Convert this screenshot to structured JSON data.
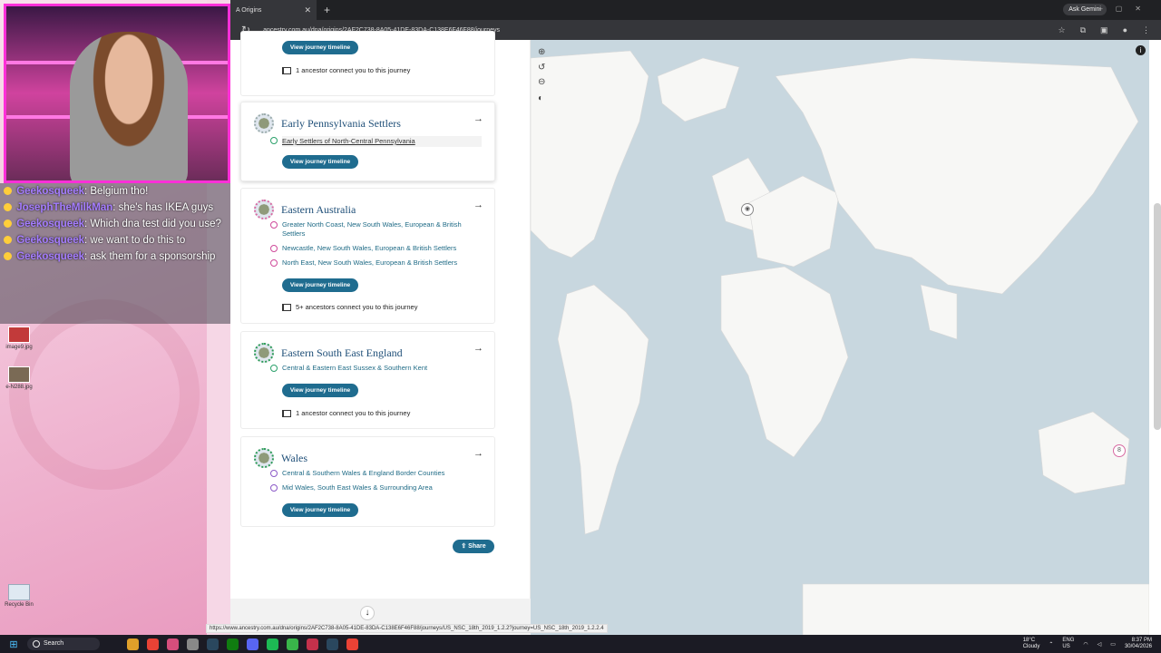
{
  "desktop": {
    "icons": [
      {
        "label": "image9.jpg"
      },
      {
        "label": "e-N288.jpg"
      },
      {
        "label": "Recycle Bin"
      }
    ]
  },
  "chat": {
    "messages": [
      {
        "user": "Geekosqueek",
        "text": ": Belgium tho!"
      },
      {
        "user": "JosephTheMilkMan",
        "text": ": she's has IKEA guys"
      },
      {
        "user": "Geekosqueek",
        "text": ": Which dna test did you use?"
      },
      {
        "user": "Geekosqueek",
        "text": ": we want to do this to"
      },
      {
        "user": "Geekosqueek",
        "text": ": ask them for a sponsorship"
      }
    ]
  },
  "browser": {
    "tab_title": "A Origins",
    "new_tab": "+",
    "ask_gemini": "Ask Gemini",
    "url": "ancestry.com.au/dna/origins/2AF2C738-8A05-41DE-83DA-C138E6F46F88/journeys",
    "status_url": "https://www.ancestry.com.au/dna/origins/2AF2C738-8A05-41DE-83DA-C138E6F46F88/journeys/US_NSC_18th_2019_1.2.2?journey=US_NSC_18th_2019_1.2.2.4"
  },
  "journeys": {
    "timeline_label": "View journey timeline",
    "share_label": "Share",
    "top_partial": {
      "ancestor_text": "1 ancestor connect you to this journey"
    },
    "cards": [
      {
        "title": "Early Pennsylvania Settlers",
        "communities": [
          "Early Settlers of North-Central Pennsylvania"
        ]
      },
      {
        "title": "Eastern Australia",
        "communities": [
          "Greater North Coast, New South Wales, European & British Settlers",
          "Newcastle, New South Wales, European & British Settlers",
          "North East, New South Wales, European & British Settlers"
        ],
        "ancestor_text": "5+ ancestors connect you to this journey"
      },
      {
        "title": "Eastern South East England",
        "communities": [
          "Central & Eastern East Sussex & Southern Kent"
        ],
        "ancestor_text": "1 ancestor connect you to this journey"
      },
      {
        "title": "Wales",
        "communities": [
          "Central & Southern Wales & England Border Counties",
          "Mid Wales, South East Wales & Surrounding Area"
        ]
      }
    ]
  },
  "map": {
    "cluster_count": "8"
  },
  "taskbar": {
    "search": "Search",
    "weather_temp": "18°C",
    "weather_desc": "Cloudy",
    "lang": "ENG",
    "region": "US",
    "time": "8:37 PM",
    "date": "30/04/2026"
  }
}
